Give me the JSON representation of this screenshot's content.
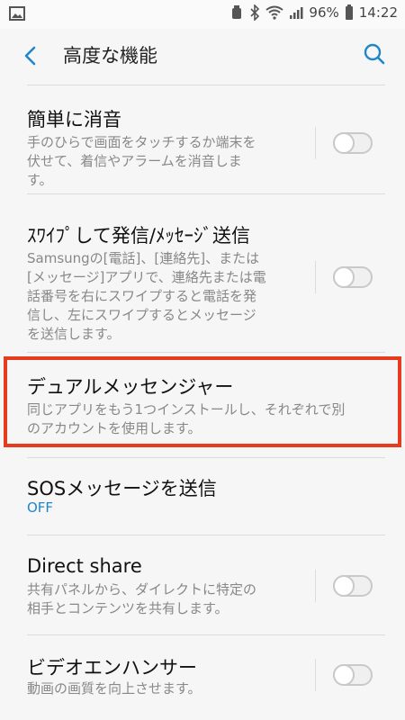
{
  "status_bar": {
    "battery": "96%",
    "time": "14:22",
    "icons": [
      "image-icon",
      "alarm-icon",
      "bluetooth-icon",
      "wifi-icon",
      "signal-icon",
      "battery-icon"
    ]
  },
  "header": {
    "title": "高度な機能"
  },
  "items": [
    {
      "title": "簡単に消音",
      "desc_lines": [
        "手のひらで画面をタッチするか端末を",
        "伏せて、着信やアラームを消音しま",
        "す。"
      ],
      "toggle": "off"
    },
    {
      "title": "ｽﾜｲﾌﾟして発信/ﾒｯｾｰｼﾞ送信",
      "desc_lines": [
        "Samsungの[電話]、[連絡先]、または",
        "[メッセージ]アプリで、連絡先または電",
        "話番号を右にスワイプすると電話を発",
        "信し、左にスワイプするとメッセージ",
        "を送信します。"
      ],
      "toggle": "off"
    },
    {
      "title": "デュアルメッセンジャー",
      "desc_lines": [
        "同じアプリをもう1つインストールし、それぞれで別",
        "のアカウントを使用します。"
      ]
    },
    {
      "title": "SOSメッセージを送信",
      "status": "OFF"
    },
    {
      "title": "Direct share",
      "desc_lines": [
        "共有パネルから、ダイレクトに特定の",
        "相手とコンテンツを共有します。"
      ],
      "toggle": "off"
    },
    {
      "title": "ビデオエンハンサー",
      "desc_lines": [
        "動画の画質を向上させます。"
      ],
      "toggle": "off"
    }
  ],
  "colors": {
    "accent": "#1f87c8",
    "highlight": "#e53b1f"
  }
}
